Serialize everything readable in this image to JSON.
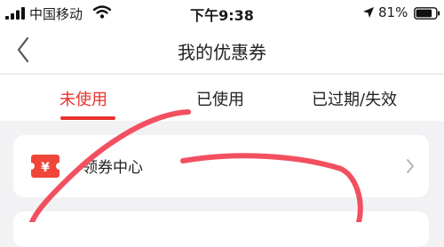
{
  "status_bar": {
    "carrier": "中国移动",
    "time": "下午9:38",
    "battery": "81%",
    "icons": [
      "signal-bars-icon",
      "wifi-icon",
      "location-arrow-icon",
      "battery-icon"
    ]
  },
  "nav": {
    "title": "我的优惠券",
    "back_icon": "chevron-left-icon"
  },
  "tabs": [
    {
      "label": "未使用",
      "active": true
    },
    {
      "label": "已使用",
      "active": false
    },
    {
      "label": "已过期/失效",
      "active": false
    }
  ],
  "coupon_center": {
    "icon": "coupon-ticket-icon",
    "icon_glyph": "¥",
    "label": "领券中心",
    "arrow_icon": "chevron-right-icon"
  },
  "colors": {
    "accent": "#e8322d",
    "background": "#f2f2f4",
    "annotation": "#f25060"
  }
}
